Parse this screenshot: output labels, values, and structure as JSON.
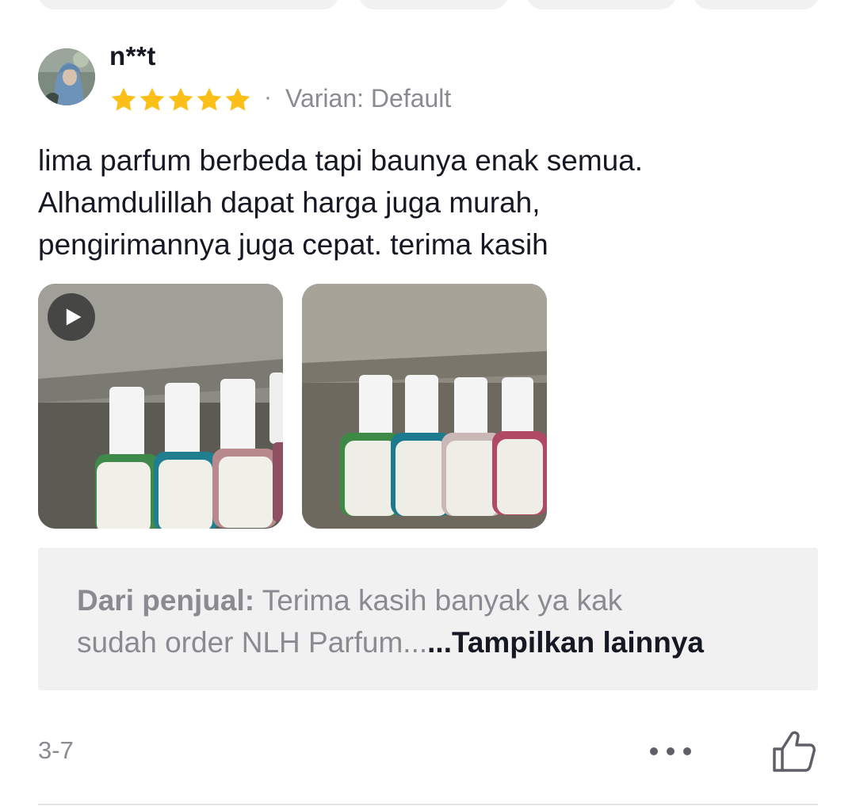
{
  "review": {
    "username": "n**t",
    "rating": 5,
    "rating_max": 5,
    "separator": "·",
    "variant": "Varian: Default",
    "text_lines": [
      "lima parfum berbeda tapi baunya enak semua.",
      "Alhamdulillah dapat harga juga murah,",
      "pengirimannya juga cepat. terima kasih"
    ],
    "media": [
      {
        "type": "video",
        "icon": "play-icon"
      },
      {
        "type": "photo"
      }
    ],
    "seller_reply": {
      "label": "Dari penjual:",
      "line1": " Terima kasih banyak ya kak",
      "line2": "sudah order NLH Parfum...",
      "show_more": "...Tampilkan lainnya"
    },
    "date": "3-7",
    "actions": {
      "more_icon": "more-horizontal-icon",
      "like_icon": "thumbs-up-icon"
    }
  },
  "colors": {
    "star": "#fcbf18",
    "muted_text": "#8a8b91",
    "primary_text": "#161823",
    "reply_background": "#f1f1f2"
  }
}
